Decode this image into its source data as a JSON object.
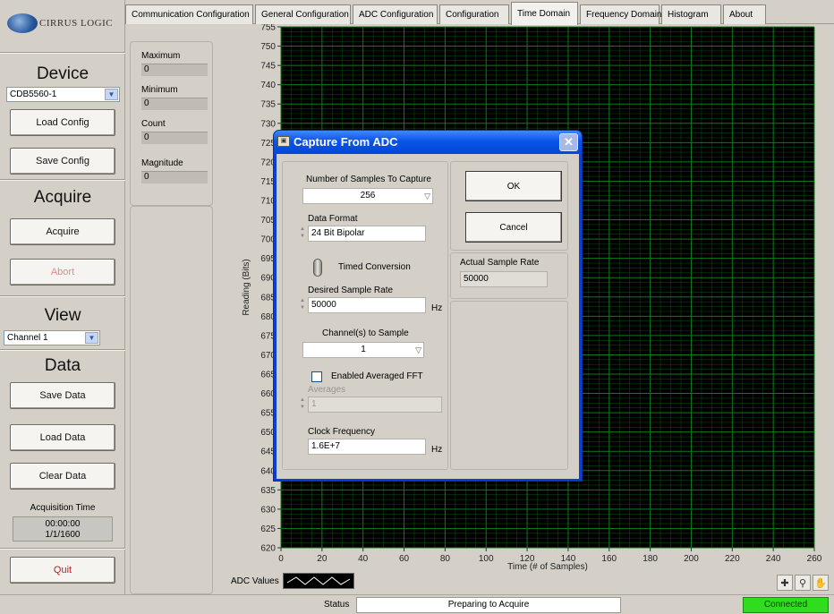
{
  "tabs": [
    "Communication Configuration",
    "General Configuration",
    "ADC Configuration",
    "Configuration",
    "Time Domain",
    "Frequency Domain",
    "Histogram",
    "About"
  ],
  "active_tab": "Time Domain",
  "sidebar": {
    "logo_text": "CIRRUS LOGIC",
    "device_title": "Device",
    "device_select": "CDB5560-1",
    "load_config": "Load Config",
    "save_config": "Save Config",
    "acquire_title": "Acquire",
    "acquire_button": "Acquire",
    "abort_button": "Abort",
    "view_title": "View",
    "channel_select": "Channel 1",
    "data_title": "Data",
    "save_data": "Save Data",
    "load_data": "Load Data",
    "clear_data": "Clear Data",
    "acq_time_label": "Acquisition Time",
    "acq_time": "00:00:00",
    "acq_date": "1/1/1600",
    "quit": "Quit"
  },
  "stats": {
    "max_label": "Maximum",
    "max": "0",
    "min_label": "Minimum",
    "min": "0",
    "count_label": "Count",
    "count": "0",
    "mag_label": "Magnitude",
    "mag": "0"
  },
  "chart_data": {
    "type": "line",
    "xlabel": "Time (# of Samples)",
    "ylabel": "Reading (Bits)",
    "xlim": [
      0,
      260
    ],
    "ylim": [
      620,
      755
    ],
    "x_ticks": [
      0,
      20,
      40,
      60,
      80,
      100,
      120,
      140,
      160,
      180,
      200,
      220,
      240,
      260
    ],
    "y_ticks": [
      755,
      750,
      745,
      740,
      735,
      730,
      725,
      720,
      715,
      710,
      705,
      700,
      695,
      690,
      685,
      680,
      675,
      670,
      665,
      660,
      655,
      650,
      645,
      640,
      635,
      630,
      625,
      620
    ],
    "background": "#000000",
    "grid_color": "#0f7a1a",
    "series": [
      {
        "name": "ADC Values",
        "values": []
      }
    ]
  },
  "legend_label": "ADC Values",
  "status": {
    "label": "Status",
    "message": "Preparing to Acquire",
    "connection": "Connected"
  },
  "dialog": {
    "title": "Capture From ADC",
    "samples_label": "Number of Samples To Capture",
    "samples": "256",
    "format_label": "Data Format",
    "format": "24 Bit  Bipolar",
    "timed_label": "Timed Conversion",
    "rate_label": "Desired Sample Rate",
    "rate": "50000",
    "hz": "Hz",
    "channels_label": "Channel(s) to Sample",
    "channels": "1",
    "fft_label": "Enabled Averaged FFT",
    "averages_label": "Averages",
    "averages": "1",
    "clock_label": "Clock Frequency",
    "clock": "1.6E+7",
    "ok": "OK",
    "cancel": "Cancel",
    "actual_rate_label": "Actual Sample Rate",
    "actual_rate": "50000"
  }
}
